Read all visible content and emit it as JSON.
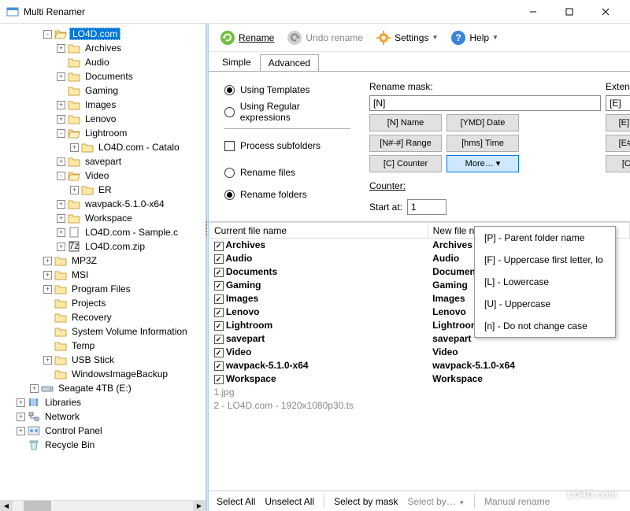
{
  "window": {
    "title": "Multi Renamer"
  },
  "toolbar": {
    "rename": "Rename",
    "undo": "Undo rename",
    "settings": "Settings",
    "help": "Help"
  },
  "tabs": {
    "simple": "Simple",
    "advanced": "Advanced"
  },
  "options": {
    "using_templates": "Using Templates",
    "using_regex": "Using Regular expressions",
    "process_subfolders": "Process subfolders",
    "rename_files": "Rename files",
    "rename_folders": "Rename folders"
  },
  "mask": {
    "rename_mask_label": "Rename mask:",
    "extension_label": "Extension:",
    "rename_mask_value": "[N]",
    "extension_value": "[E]",
    "btn_n_name": "[N] Name",
    "btn_ymd_date": "[YMD] Date",
    "btn_e_extension": "[E] Extension",
    "btn_range_n": "[N#-#] Range",
    "btn_hms_time": "[hms] Time",
    "btn_range_e": "[E#-#] Range",
    "btn_c_counter": "[C] Counter",
    "btn_more": "More…    ▾",
    "btn_c_counter2": "[C] Counter",
    "counter_label": "Counter:",
    "start_at_label": "Start at:",
    "start_at_value": "1"
  },
  "more_menu": [
    "[P] - Parent folder name",
    "[F] - Uppercase first letter, lo",
    "[L] - Lowercase",
    "[U] - Uppercase",
    "[n] - Do not change case"
  ],
  "table": {
    "col_current": "Current file name",
    "col_new": "New file name",
    "rows": [
      {
        "checked": true,
        "cur": "Archives",
        "new": "Archives"
      },
      {
        "checked": true,
        "cur": "Audio",
        "new": "Audio"
      },
      {
        "checked": true,
        "cur": "Documents",
        "new": "Documents"
      },
      {
        "checked": true,
        "cur": "Gaming",
        "new": "Gaming"
      },
      {
        "checked": true,
        "cur": "Images",
        "new": "Images"
      },
      {
        "checked": true,
        "cur": "Lenovo",
        "new": "Lenovo"
      },
      {
        "checked": true,
        "cur": "Lightroom",
        "new": "Lightroom"
      },
      {
        "checked": true,
        "cur": "savepart",
        "new": "savepart"
      },
      {
        "checked": true,
        "cur": "Video",
        "new": "Video"
      },
      {
        "checked": true,
        "cur": "wavpack-5.1.0-x64",
        "new": "wavpack-5.1.0-x64"
      },
      {
        "checked": true,
        "cur": "Workspace",
        "new": "Workspace"
      }
    ],
    "dim_rows": [
      {
        "text": "1.jpg"
      },
      {
        "text": "2 - LO4D.com - 1920x1080p30.ts"
      }
    ]
  },
  "bottombar": {
    "select_all": "Select All",
    "unselect_all": "Unselect All",
    "select_by_mask": "Select by mask",
    "select_by": "Select by…",
    "manual_rename": "Manual rename"
  },
  "tree": [
    {
      "indent": 3,
      "exp": "-",
      "icon": "folder-open",
      "label": "LO4D.com",
      "selected": true
    },
    {
      "indent": 4,
      "exp": "+",
      "icon": "folder",
      "label": "Archives"
    },
    {
      "indent": 4,
      "exp": "",
      "icon": "folder",
      "label": "Audio"
    },
    {
      "indent": 4,
      "exp": "+",
      "icon": "folder",
      "label": "Documents"
    },
    {
      "indent": 4,
      "exp": "",
      "icon": "folder",
      "label": "Gaming"
    },
    {
      "indent": 4,
      "exp": "+",
      "icon": "folder",
      "label": "Images"
    },
    {
      "indent": 4,
      "exp": "+",
      "icon": "folder",
      "label": "Lenovo"
    },
    {
      "indent": 4,
      "exp": "-",
      "icon": "folder-open",
      "label": "Lightroom"
    },
    {
      "indent": 5,
      "exp": "+",
      "icon": "folder",
      "label": "LO4D.com - Catalo"
    },
    {
      "indent": 4,
      "exp": "+",
      "icon": "folder",
      "label": "savepart"
    },
    {
      "indent": 4,
      "exp": "-",
      "icon": "folder-open",
      "label": "Video"
    },
    {
      "indent": 5,
      "exp": "+",
      "icon": "folder",
      "label": "ER"
    },
    {
      "indent": 4,
      "exp": "+",
      "icon": "folder",
      "label": "wavpack-5.1.0-x64"
    },
    {
      "indent": 4,
      "exp": "+",
      "icon": "folder",
      "label": "Workspace"
    },
    {
      "indent": 4,
      "exp": "+",
      "icon": "file",
      "label": "LO4D.com - Sample.c"
    },
    {
      "indent": 4,
      "exp": "+",
      "icon": "zip",
      "label": "LO4D.com.zip"
    },
    {
      "indent": 3,
      "exp": "+",
      "icon": "folder",
      "label": "MP3Z"
    },
    {
      "indent": 3,
      "exp": "+",
      "icon": "folder",
      "label": "MSI"
    },
    {
      "indent": 3,
      "exp": "+",
      "icon": "folder",
      "label": "Program Files"
    },
    {
      "indent": 3,
      "exp": "",
      "icon": "folder",
      "label": "Projects"
    },
    {
      "indent": 3,
      "exp": "",
      "icon": "folder",
      "label": "Recovery"
    },
    {
      "indent": 3,
      "exp": "",
      "icon": "folder",
      "label": "System Volume Information"
    },
    {
      "indent": 3,
      "exp": "",
      "icon": "folder",
      "label": "Temp"
    },
    {
      "indent": 3,
      "exp": "+",
      "icon": "folder",
      "label": "USB Stick"
    },
    {
      "indent": 3,
      "exp": "",
      "icon": "folder",
      "label": "WindowsImageBackup"
    },
    {
      "indent": 2,
      "exp": "+",
      "icon": "drive",
      "label": "Seagate 4TB (E:)"
    },
    {
      "indent": 1,
      "exp": "+",
      "icon": "lib",
      "label": "Libraries"
    },
    {
      "indent": 1,
      "exp": "+",
      "icon": "net",
      "label": "Network"
    },
    {
      "indent": 1,
      "exp": "+",
      "icon": "cpanel",
      "label": "Control Panel"
    },
    {
      "indent": 1,
      "exp": "",
      "icon": "bin",
      "label": "Recycle Bin"
    }
  ],
  "watermark": "LO4D.com"
}
